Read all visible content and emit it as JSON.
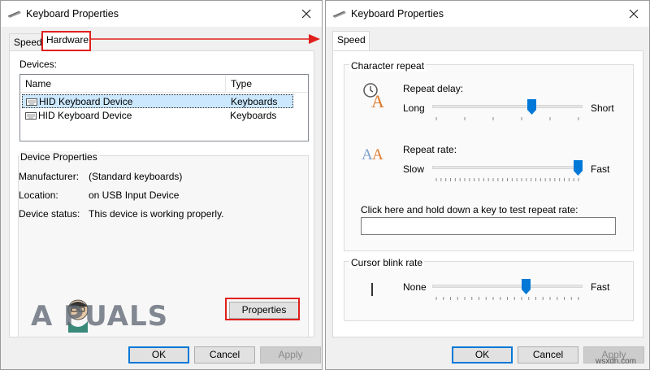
{
  "left_window": {
    "title": "Keyboard Properties",
    "tabs": [
      {
        "label": "Speed"
      },
      {
        "label": "Hardware"
      }
    ],
    "devices_label": "Devices:",
    "columns": [
      "Name",
      "Type"
    ],
    "rows": [
      {
        "name": "HID Keyboard Device",
        "type": "Keyboards"
      },
      {
        "name": "HID Keyboard Device",
        "type": "Keyboards"
      }
    ],
    "device_properties": {
      "label": "Device Properties",
      "manufacturer_label": "Manufacturer:",
      "manufacturer_value": "(Standard keyboards)",
      "location_label": "Location:",
      "location_value": "on USB Input Device",
      "status_label": "Device status:",
      "status_value": "This device is working properly."
    },
    "properties_button": "Properties",
    "buttons": {
      "ok": "OK",
      "cancel": "Cancel",
      "apply": "Apply"
    }
  },
  "right_window": {
    "title": "Keyboard Properties",
    "tab": "Speed",
    "character_repeat": {
      "label": "Character repeat",
      "repeat_delay": {
        "label": "Repeat delay:",
        "min_label": "Long",
        "max_label": "Short",
        "value": 0.67
      },
      "repeat_rate": {
        "label": "Repeat rate:",
        "min_label": "Slow",
        "max_label": "Fast",
        "value": 1.0
      },
      "test_label": "Click here and hold down a key to test repeat rate:",
      "test_value": ""
    },
    "cursor_blink": {
      "label": "Cursor blink rate",
      "min_label": "None",
      "max_label": "Fast",
      "value": 0.63
    },
    "buttons": {
      "ok": "OK",
      "cancel": "Cancel",
      "apply": "Apply"
    }
  },
  "watermarks": {
    "appuals": "A PUALS",
    "site": "wsxdn.com"
  },
  "colors": {
    "highlight": "#e0201c",
    "accent": "#0078d7",
    "selection": "#cce8ff"
  }
}
